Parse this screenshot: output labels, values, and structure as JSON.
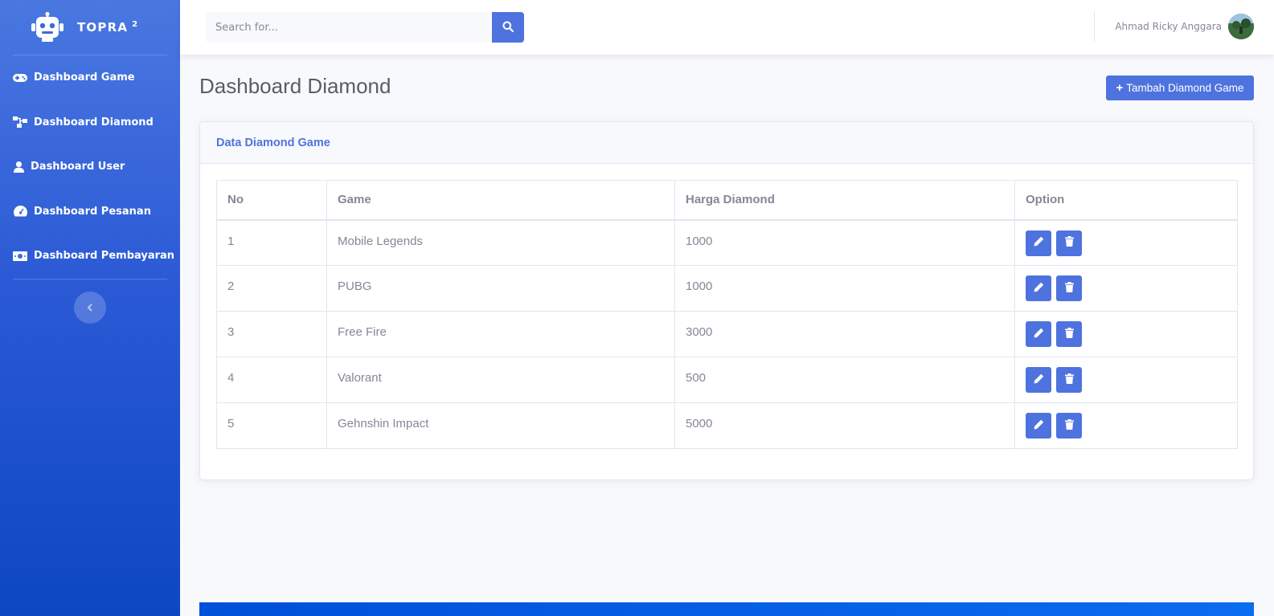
{
  "sidebar": {
    "brand": {
      "name": "TOPRA",
      "sup": "2"
    },
    "items": [
      {
        "label": "Dashboard Game",
        "icon": "gamepad-icon"
      },
      {
        "label": "Dashboard Diamond",
        "icon": "sitemap-icon"
      },
      {
        "label": "Dashboard User",
        "icon": "user-icon"
      },
      {
        "label": "Dashboard Pesanan",
        "icon": "gauge-icon"
      },
      {
        "label": "Dashboard Pembayaran",
        "icon": "money-bill-icon"
      }
    ]
  },
  "topbar": {
    "search": {
      "placeholder": "Search for..."
    },
    "user": {
      "name": "Ahmad Ricky Anggara"
    }
  },
  "main": {
    "title": "Dashboard Diamond",
    "add_button": "Tambah Diamond Game",
    "card": {
      "title": "Data Diamond Game",
      "columns": [
        "No",
        "Game",
        "Harga Diamond",
        "Option"
      ],
      "rows": [
        {
          "no": "1",
          "game": "Mobile Legends",
          "harga": "1000"
        },
        {
          "no": "2",
          "game": "PUBG",
          "harga": "1000"
        },
        {
          "no": "3",
          "game": "Free Fire",
          "harga": "3000"
        },
        {
          "no": "4",
          "game": "Valorant",
          "harga": "500"
        },
        {
          "no": "5",
          "game": "Gehnshin Impact",
          "harga": "5000"
        }
      ]
    }
  },
  "colors": {
    "primary": "#4e73df",
    "sidebar_top": "#4a78e0",
    "sidebar_bottom": "#0d47c2",
    "text": "#858796"
  }
}
